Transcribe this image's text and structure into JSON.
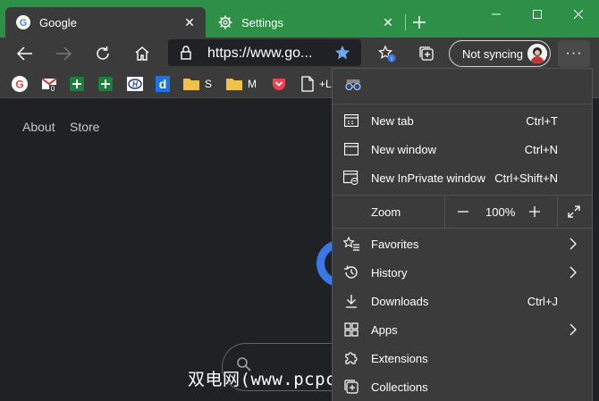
{
  "tabs": [
    {
      "title": "Google",
      "active": true
    },
    {
      "title": "Settings",
      "active": false
    }
  ],
  "address": {
    "url": "https://www.go..."
  },
  "profile": {
    "sync_label": "Not syncing"
  },
  "bookmarks": [
    {
      "icon": "google-icon"
    },
    {
      "icon": "gmail-icon",
      "badge": "0"
    },
    {
      "icon": "green-plus-icon"
    },
    {
      "icon": "green-plus-icon"
    },
    {
      "icon": "hyundai-icon"
    },
    {
      "icon": "d-icon"
    },
    {
      "icon": "folder-icon",
      "label": "S"
    },
    {
      "icon": "folder-icon",
      "label": "M"
    },
    {
      "icon": "pocket-icon"
    },
    {
      "icon": "page-icon",
      "label": "+L"
    }
  ],
  "google_links": {
    "about": "About",
    "store": "Store"
  },
  "menu": {
    "new_tab": {
      "label": "New tab",
      "shortcut": "Ctrl+T"
    },
    "new_window": {
      "label": "New window",
      "shortcut": "Ctrl+N"
    },
    "new_private": {
      "label": "New InPrivate window",
      "shortcut": "Ctrl+Shift+N"
    },
    "zoom": {
      "label": "Zoom",
      "value": "100%"
    },
    "favorites": {
      "label": "Favorites"
    },
    "history": {
      "label": "History"
    },
    "downloads": {
      "label": "Downloads",
      "shortcut": "Ctrl+J"
    },
    "apps": {
      "label": "Apps"
    },
    "extensions": {
      "label": "Extensions"
    },
    "collections": {
      "label": "Collections"
    }
  },
  "watermark": "双电网(www.pcpc.me)",
  "colors": {
    "titlebar": "#2e8f47",
    "toolbar": "#3b3b3b",
    "page": "#202124",
    "menu": "#3b3b3b"
  }
}
